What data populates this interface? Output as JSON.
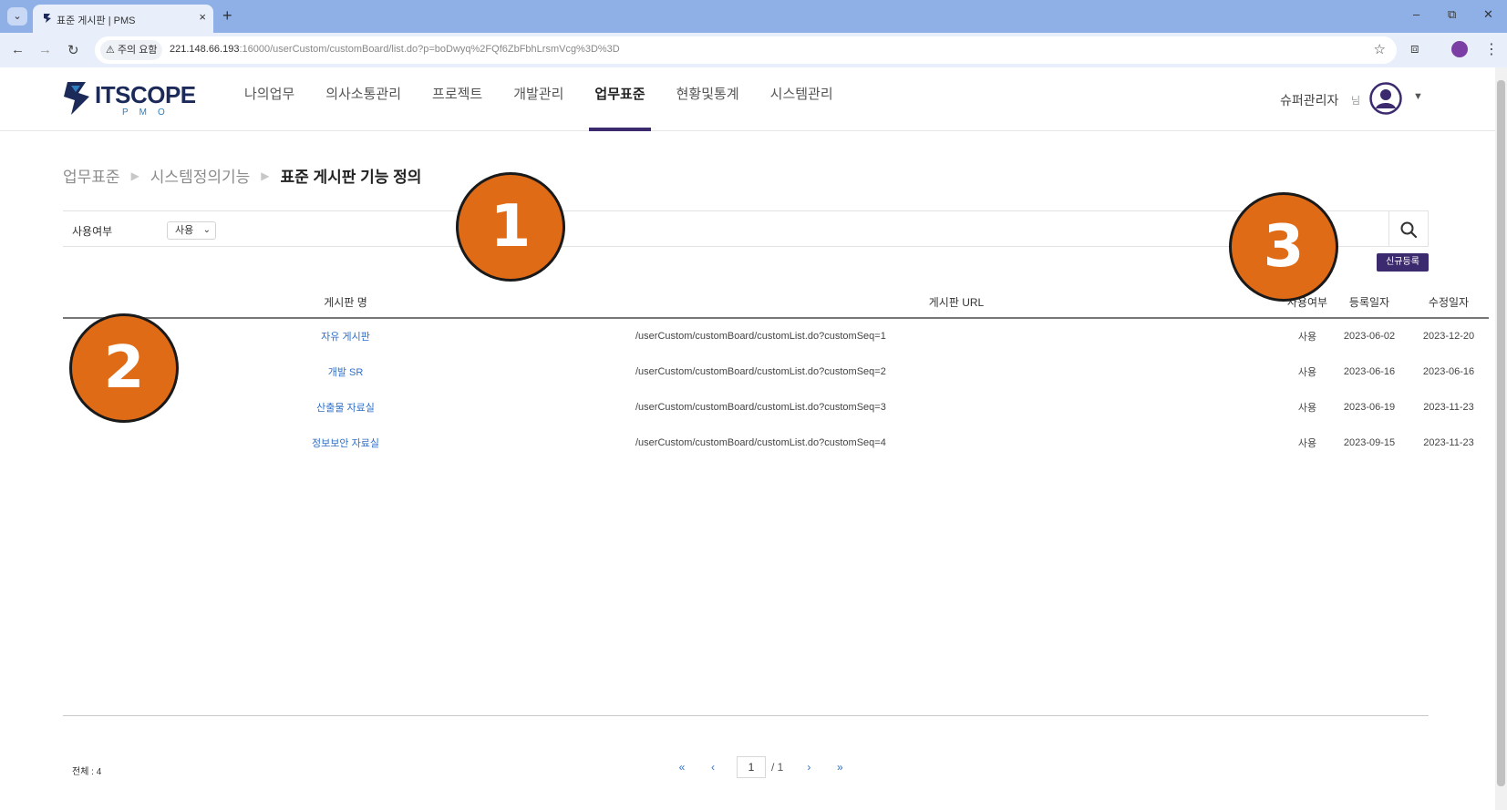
{
  "browser": {
    "tab_title": "표준 게시판 | PMS",
    "security_label": "주의 요함",
    "url_host": "221.148.66.193",
    "url_rest": ":16000/userCustom/customBoard/list.do?p=boDwyq%2FQf6ZbFbhLrsmVcg%3D%3D"
  },
  "header": {
    "logo_text": "ITSCOPE",
    "logo_sub": "PMO",
    "nav": [
      "나의업무",
      "의사소통관리",
      "프로젝트",
      "개발관리",
      "업무표준",
      "현황및통계",
      "시스템관리"
    ],
    "active_nav": "업무표준",
    "user_name": "슈퍼관리자",
    "user_suffix": "님"
  },
  "breadcrumb": {
    "level1": "업무표준",
    "level2": "시스템정의기능",
    "current": "표준 게시판 기능 정의"
  },
  "search": {
    "label": "사용여부",
    "selected": "사용"
  },
  "new_button": "신규등록",
  "table": {
    "columns": [
      "게시판 명",
      "게시판 URL",
      "사용여부",
      "등록일자",
      "수정일자"
    ],
    "rows": [
      {
        "name": "자유 게시판",
        "url": "/userCustom/customBoard/customList.do?customSeq=1",
        "use": "사용",
        "created": "2023-06-02",
        "updated": "2023-12-20"
      },
      {
        "name": "개발 SR",
        "url": "/userCustom/customBoard/customList.do?customSeq=2",
        "use": "사용",
        "created": "2023-06-16",
        "updated": "2023-06-16"
      },
      {
        "name": "산출물 자료실",
        "url": "/userCustom/customBoard/customList.do?customSeq=3",
        "use": "사용",
        "created": "2023-06-19",
        "updated": "2023-11-23"
      },
      {
        "name": "정보보안 자료실",
        "url": "/userCustom/customBoard/customList.do?customSeq=4",
        "use": "사용",
        "created": "2023-09-15",
        "updated": "2023-11-23"
      }
    ]
  },
  "footer": {
    "total": "전체 : 4",
    "current_page": "1",
    "page_total": "/ 1"
  },
  "callouts": [
    "1",
    "2",
    "3"
  ],
  "colors": {
    "accent": "#3b2a6e",
    "link": "#2f6fc9",
    "callout": "#e06b17"
  }
}
